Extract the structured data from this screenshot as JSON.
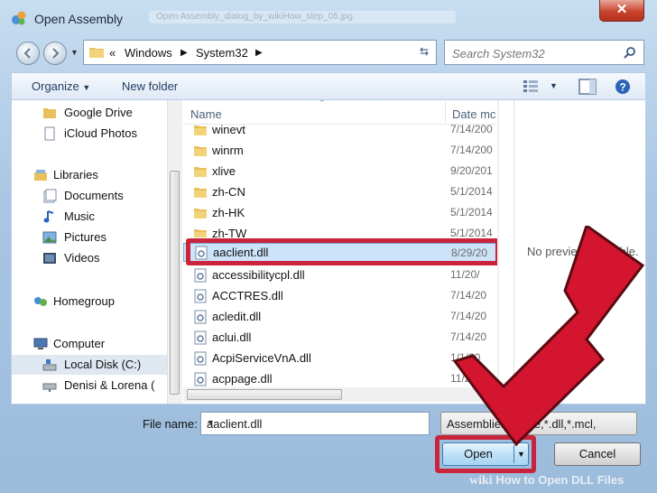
{
  "window": {
    "title": "Open Assembly",
    "blurred_url": "Open Assembly_dialog_by_wikiHow_step_05.jpg",
    "close": "✕"
  },
  "address": {
    "separator": "«",
    "crumbs": [
      "Windows",
      "System32"
    ]
  },
  "search": {
    "placeholder": "Search System32"
  },
  "toolbar": {
    "organize": "Organize",
    "new_folder": "New folder"
  },
  "nav": {
    "items": [
      {
        "label": "Google Drive",
        "icon": "folder-icon"
      },
      {
        "label": "iCloud Photos",
        "icon": "document-icon"
      },
      {
        "label": "Libraries",
        "icon": "libraries-icon"
      },
      {
        "label": "Documents",
        "icon": "documents-icon"
      },
      {
        "label": "Music",
        "icon": "music-icon"
      },
      {
        "label": "Pictures",
        "icon": "pictures-icon"
      },
      {
        "label": "Videos",
        "icon": "videos-icon"
      },
      {
        "label": "Homegroup",
        "icon": "homegroup-icon"
      },
      {
        "label": "Computer",
        "icon": "computer-icon"
      },
      {
        "label": "Local Disk (C:)",
        "icon": "disk-icon"
      },
      {
        "label": "Denisi & Lorena (",
        "icon": "network-drive-icon"
      }
    ]
  },
  "columns": {
    "name": "Name",
    "date": "Date mc"
  },
  "files": [
    {
      "name": "winevt",
      "date": "7/14/200",
      "type": "folder"
    },
    {
      "name": "winrm",
      "date": "7/14/200",
      "type": "folder"
    },
    {
      "name": "xlive",
      "date": "9/20/201",
      "type": "folder"
    },
    {
      "name": "zh-CN",
      "date": "5/1/2014",
      "type": "folder"
    },
    {
      "name": "zh-HK",
      "date": "5/1/2014",
      "type": "folder"
    },
    {
      "name": "zh-TW",
      "date": "5/1/2014",
      "type": "folder"
    },
    {
      "name": "aaclient.dll",
      "date": "8/29/20",
      "type": "dll",
      "selected": true
    },
    {
      "name": "accessibilitycpl.dll",
      "date": "11/20/",
      "type": "dll"
    },
    {
      "name": "ACCTRES.dll",
      "date": "7/14/20",
      "type": "dll"
    },
    {
      "name": "acledit.dll",
      "date": "7/14/20",
      "type": "dll"
    },
    {
      "name": "aclui.dll",
      "date": "7/14/20",
      "type": "dll"
    },
    {
      "name": "AcpiServiceVnA.dll",
      "date": "1/1/20",
      "type": "dll"
    },
    {
      "name": "acppage.dll",
      "date": "11/20/",
      "type": "dll"
    }
  ],
  "preview": {
    "text": "No preview available."
  },
  "footer": {
    "file_name_label": "File name:",
    "file_name_value": "aaclient.dll",
    "filter": "Assemblies (*.exe,*.dll,*.mcl,",
    "open": "Open",
    "cancel": "Cancel"
  },
  "watermark": {
    "brand": "wiki",
    "text": "How to Open DLL Files"
  },
  "colors": {
    "highlight": "#c9243b",
    "arrow": "#d4152f"
  }
}
